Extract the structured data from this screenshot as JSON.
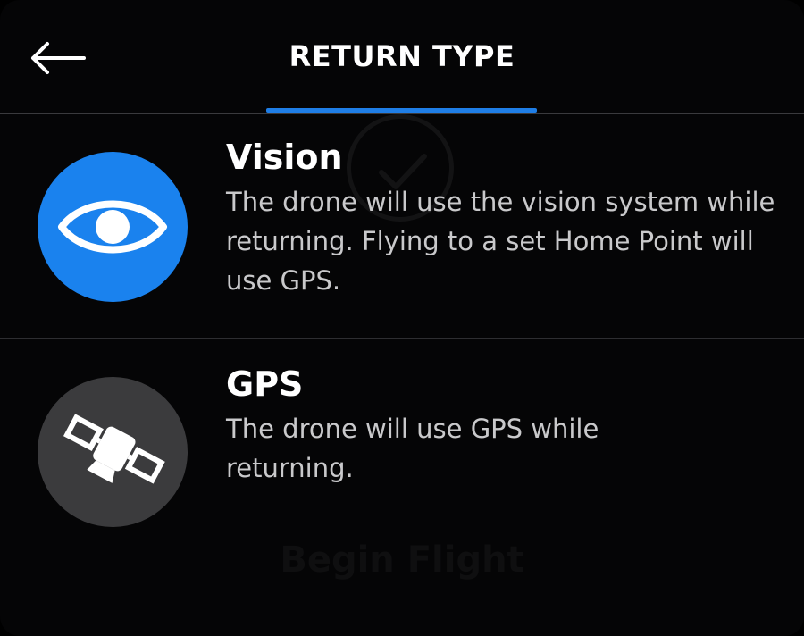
{
  "header": {
    "title": "RETURN TYPE",
    "back_icon": "arrow-left-icon"
  },
  "options": [
    {
      "title": "Vision",
      "description": "The drone will use the vision system while returning. Flying to a set Home Point will use GPS.",
      "icon": "eye-icon",
      "icon_bg": "#1a82ee"
    },
    {
      "title": "GPS",
      "description": "The drone will use GPS while returning.",
      "icon": "satellite-icon",
      "icon_bg": "#3b3b3d"
    }
  ],
  "background": {
    "button_label": "Begin Flight"
  },
  "colors": {
    "accent": "#1f7ee6",
    "background": "#050506"
  }
}
